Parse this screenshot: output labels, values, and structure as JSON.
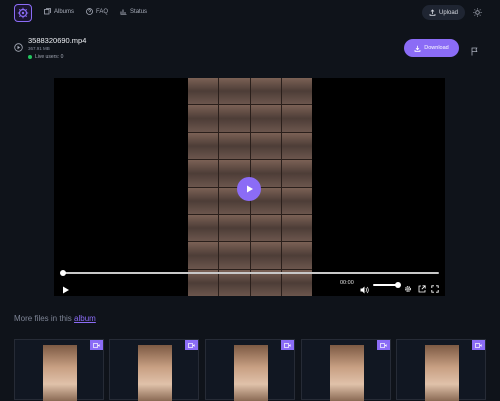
{
  "header": {
    "nav": [
      {
        "label": "Albums",
        "icon": "albums-icon"
      },
      {
        "label": "FAQ",
        "icon": "help-icon"
      },
      {
        "label": "Status",
        "icon": "chart-icon"
      }
    ],
    "upload_label": "Upload"
  },
  "file": {
    "name": "3588320690.mp4",
    "size": "367.91 MB",
    "live_users": "Live users: 0",
    "download_label": "Download"
  },
  "player": {
    "time": "00:00",
    "progress": 0,
    "volume": 0.92
  },
  "more": {
    "prefix": "More files in this ",
    "link": "album"
  },
  "colors": {
    "accent": "#8b6cf6",
    "background": "#0f131a",
    "live": "#22c55e"
  },
  "cards": [
    {
      "icon": "video-icon"
    },
    {
      "icon": "video-icon"
    },
    {
      "icon": "video-icon"
    },
    {
      "icon": "video-icon"
    },
    {
      "icon": "video-icon"
    }
  ]
}
